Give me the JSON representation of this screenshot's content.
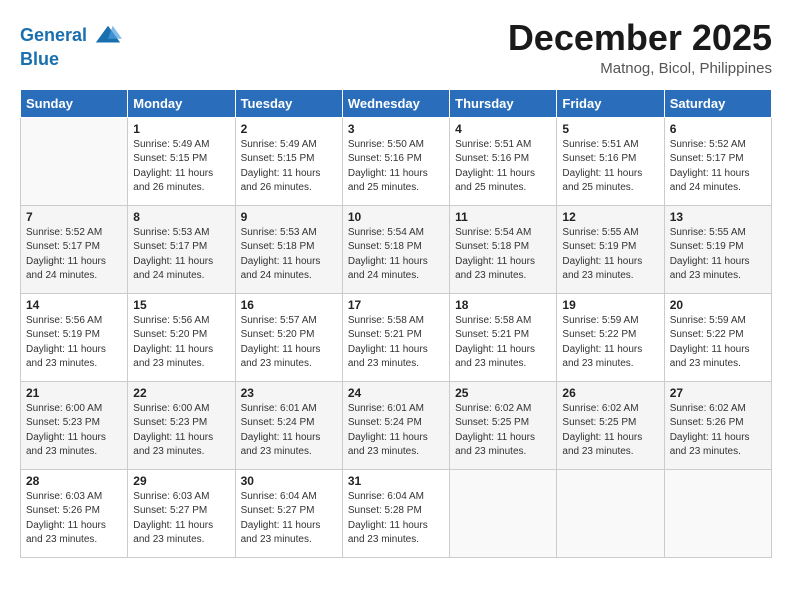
{
  "header": {
    "logo_line1": "General",
    "logo_line2": "Blue",
    "month": "December 2025",
    "location": "Matnog, Bicol, Philippines"
  },
  "days_of_week": [
    "Sunday",
    "Monday",
    "Tuesday",
    "Wednesday",
    "Thursday",
    "Friday",
    "Saturday"
  ],
  "weeks": [
    [
      {
        "day": "",
        "info": ""
      },
      {
        "day": "1",
        "info": "Sunrise: 5:49 AM\nSunset: 5:15 PM\nDaylight: 11 hours\nand 26 minutes."
      },
      {
        "day": "2",
        "info": "Sunrise: 5:49 AM\nSunset: 5:15 PM\nDaylight: 11 hours\nand 26 minutes."
      },
      {
        "day": "3",
        "info": "Sunrise: 5:50 AM\nSunset: 5:16 PM\nDaylight: 11 hours\nand 25 minutes."
      },
      {
        "day": "4",
        "info": "Sunrise: 5:51 AM\nSunset: 5:16 PM\nDaylight: 11 hours\nand 25 minutes."
      },
      {
        "day": "5",
        "info": "Sunrise: 5:51 AM\nSunset: 5:16 PM\nDaylight: 11 hours\nand 25 minutes."
      },
      {
        "day": "6",
        "info": "Sunrise: 5:52 AM\nSunset: 5:17 PM\nDaylight: 11 hours\nand 24 minutes."
      }
    ],
    [
      {
        "day": "7",
        "info": "Sunrise: 5:52 AM\nSunset: 5:17 PM\nDaylight: 11 hours\nand 24 minutes."
      },
      {
        "day": "8",
        "info": "Sunrise: 5:53 AM\nSunset: 5:17 PM\nDaylight: 11 hours\nand 24 minutes."
      },
      {
        "day": "9",
        "info": "Sunrise: 5:53 AM\nSunset: 5:18 PM\nDaylight: 11 hours\nand 24 minutes."
      },
      {
        "day": "10",
        "info": "Sunrise: 5:54 AM\nSunset: 5:18 PM\nDaylight: 11 hours\nand 24 minutes."
      },
      {
        "day": "11",
        "info": "Sunrise: 5:54 AM\nSunset: 5:18 PM\nDaylight: 11 hours\nand 23 minutes."
      },
      {
        "day": "12",
        "info": "Sunrise: 5:55 AM\nSunset: 5:19 PM\nDaylight: 11 hours\nand 23 minutes."
      },
      {
        "day": "13",
        "info": "Sunrise: 5:55 AM\nSunset: 5:19 PM\nDaylight: 11 hours\nand 23 minutes."
      }
    ],
    [
      {
        "day": "14",
        "info": "Sunrise: 5:56 AM\nSunset: 5:19 PM\nDaylight: 11 hours\nand 23 minutes."
      },
      {
        "day": "15",
        "info": "Sunrise: 5:56 AM\nSunset: 5:20 PM\nDaylight: 11 hours\nand 23 minutes."
      },
      {
        "day": "16",
        "info": "Sunrise: 5:57 AM\nSunset: 5:20 PM\nDaylight: 11 hours\nand 23 minutes."
      },
      {
        "day": "17",
        "info": "Sunrise: 5:58 AM\nSunset: 5:21 PM\nDaylight: 11 hours\nand 23 minutes."
      },
      {
        "day": "18",
        "info": "Sunrise: 5:58 AM\nSunset: 5:21 PM\nDaylight: 11 hours\nand 23 minutes."
      },
      {
        "day": "19",
        "info": "Sunrise: 5:59 AM\nSunset: 5:22 PM\nDaylight: 11 hours\nand 23 minutes."
      },
      {
        "day": "20",
        "info": "Sunrise: 5:59 AM\nSunset: 5:22 PM\nDaylight: 11 hours\nand 23 minutes."
      }
    ],
    [
      {
        "day": "21",
        "info": "Sunrise: 6:00 AM\nSunset: 5:23 PM\nDaylight: 11 hours\nand 23 minutes."
      },
      {
        "day": "22",
        "info": "Sunrise: 6:00 AM\nSunset: 5:23 PM\nDaylight: 11 hours\nand 23 minutes."
      },
      {
        "day": "23",
        "info": "Sunrise: 6:01 AM\nSunset: 5:24 PM\nDaylight: 11 hours\nand 23 minutes."
      },
      {
        "day": "24",
        "info": "Sunrise: 6:01 AM\nSunset: 5:24 PM\nDaylight: 11 hours\nand 23 minutes."
      },
      {
        "day": "25",
        "info": "Sunrise: 6:02 AM\nSunset: 5:25 PM\nDaylight: 11 hours\nand 23 minutes."
      },
      {
        "day": "26",
        "info": "Sunrise: 6:02 AM\nSunset: 5:25 PM\nDaylight: 11 hours\nand 23 minutes."
      },
      {
        "day": "27",
        "info": "Sunrise: 6:02 AM\nSunset: 5:26 PM\nDaylight: 11 hours\nand 23 minutes."
      }
    ],
    [
      {
        "day": "28",
        "info": "Sunrise: 6:03 AM\nSunset: 5:26 PM\nDaylight: 11 hours\nand 23 minutes."
      },
      {
        "day": "29",
        "info": "Sunrise: 6:03 AM\nSunset: 5:27 PM\nDaylight: 11 hours\nand 23 minutes."
      },
      {
        "day": "30",
        "info": "Sunrise: 6:04 AM\nSunset: 5:27 PM\nDaylight: 11 hours\nand 23 minutes."
      },
      {
        "day": "31",
        "info": "Sunrise: 6:04 AM\nSunset: 5:28 PM\nDaylight: 11 hours\nand 23 minutes."
      },
      {
        "day": "",
        "info": ""
      },
      {
        "day": "",
        "info": ""
      },
      {
        "day": "",
        "info": ""
      }
    ]
  ]
}
